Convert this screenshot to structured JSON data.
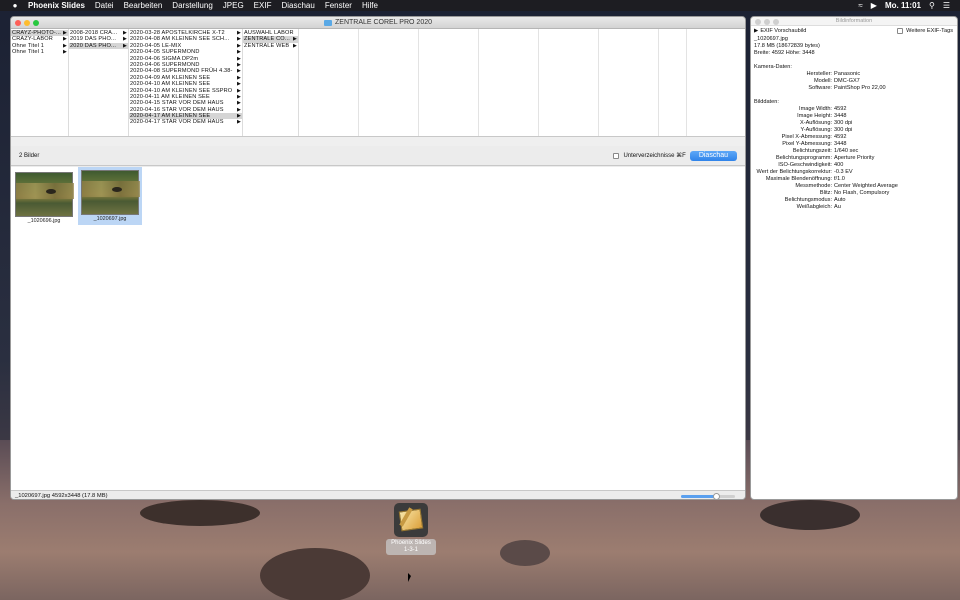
{
  "menubar": {
    "apple": "",
    "items": [
      "Phoenix Slides",
      "Datei",
      "Bearbeiten",
      "Darstellung",
      "JPEG",
      "EXIF",
      "Diaschau",
      "Fenster",
      "Hilfe"
    ],
    "clock": "Mo. 11:01"
  },
  "main_window": {
    "title": "ZENTRALE  COREL  PRO 2020",
    "col1": [
      "CRAYZ-PHOTO-...",
      "CRAZY-LABOR",
      "Ohne Titel 1",
      "Ohne Titel 1"
    ],
    "col2": [
      "2008-2018  CRA...",
      "2019  DAS  PHO...",
      "2020  DAS  PHO..."
    ],
    "col3": [
      "2020-03-28  APOSTELKIRCHE  X-T2",
      "2020-04-08  AM  KLEINEN  SEE  SCH...",
      "2020-04-05  LE-MIX",
      "2020-04-05  SUPERMOND",
      "2020-04-06  SIGMA  DP2m",
      "2020-04-06  SUPERMOND",
      "2020-04-08  SUPERMOND  FRÜH 4.38-",
      "2020-04-09  AM  KLEINEN  SEE",
      "2020-04-10  AM  KLEINEN  SEE",
      "2020-04-10  AM  KLEINEN  SEE  SSPRO",
      "2020-04-11  AM  KLEINEN  SEE",
      "2020-04-15  STAR  VOR  DEM  HAUS",
      "2020-04-16  STAR  VOR  DEM  HAUS",
      "2020-04-17  AM  KLEINEN  SEE",
      "2020-04-17  STAR  VOR  DEM  HAUS"
    ],
    "col4": [
      "AUSWAHL  LABOR",
      "ZENTRALE  CO...",
      "ZENTRALE  WEB"
    ],
    "image_count": "2 Bilder",
    "subfolders_label": "Unterverzeichnisse ⌘F",
    "slideshow_button": "Diaschau",
    "thumbnails": [
      "_1020696.jpg",
      "_1020697.jpg"
    ],
    "status": "_1020697.jpg 4592x3448 (17.8 MB)",
    "zoom_fraction": 0.65
  },
  "info_window": {
    "title": "Bildinformation",
    "exif_preview": "EXIF Vorschaubild",
    "more_exif": "Weitere EXIF-Tags",
    "filename": "_1020697.jpg",
    "filesize": "17.8 MB (18672839 bytes)",
    "dimensions": "Breite: 4592 Höhe: 3448",
    "camera_heading": "Kamera-Daten:",
    "camera": [
      {
        "k": "Hersteller:",
        "v": "Panasonic"
      },
      {
        "k": "Modell:",
        "v": "DMC-GX7"
      },
      {
        "k": "Software:",
        "v": "PaintShop Pro 22,00"
      }
    ],
    "image_heading": "Bilddaten:",
    "image": [
      {
        "k": "Image Width:",
        "v": "4592"
      },
      {
        "k": "Image Height:",
        "v": "3448"
      },
      {
        "k": "X-Auflösung:",
        "v": "300 dpi"
      },
      {
        "k": "Y-Auflösung:",
        "v": "300 dpi"
      },
      {
        "k": "Pixel X-Abmessung:",
        "v": "4592"
      },
      {
        "k": "Pixel Y-Abmessung:",
        "v": "3448"
      },
      {
        "k": "Belichtungszeit:",
        "v": "1/640 sec"
      },
      {
        "k": "Belichtungsprogramm:",
        "v": "Aperture Priority"
      },
      {
        "k": "ISO-Geschwindigkeit:",
        "v": "400"
      },
      {
        "k": "Wert der Belichtungskorrektur:",
        "v": "-0.3 EV"
      },
      {
        "k": "Maximale Blendenöffnung:",
        "v": "f/1.0"
      },
      {
        "k": "Messmethode:",
        "v": "Center Weighted Average"
      },
      {
        "k": "Blitz:",
        "v": "No Flash, Compulsory"
      },
      {
        "k": "Belichtungsmodus:",
        "v": "Auto"
      },
      {
        "k": "Weißabgleich:",
        "v": "Au"
      }
    ]
  },
  "dock": {
    "label": "Phoenix Slides",
    "sublabel": "1-3-1"
  }
}
